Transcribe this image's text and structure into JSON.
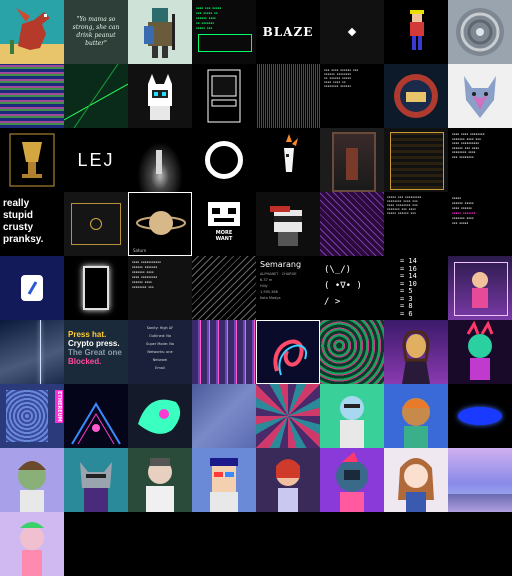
{
  "tiles": {
    "r1": {
      "quote": "\"Yo mama so strong, she can drink peanut butter\"",
      "blaze_logo": "BLAZE"
    },
    "r2": {},
    "r3": {
      "lej_text": "LEJ",
      "stupid_text": "really stupid crusty pranksy."
    },
    "r4": {
      "saturn_caption": "Saturn",
      "robot_word1": "MORE",
      "robot_word2": "WANT"
    },
    "r5": {
      "city_title": "Semarang",
      "city_lines": [
        "ALPHANET · CHARGE",
        "6.37 m",
        "Hilly",
        "1,995,388",
        "Kota Madya"
      ],
      "kaomoji": [
        "(\\_/)",
        "( •∇• )",
        "/ >"
      ],
      "numbers_eq": [
        "= 14",
        "= 16",
        "= 14",
        "= 10",
        "= 5",
        "= 3",
        "= 8",
        "= 6"
      ]
    },
    "r6": {
      "press_line1": "Press hat.",
      "press_line2": "Crypto press.",
      "press_line3": "The Great one",
      "press_line4": "Blocked.",
      "settings_lines": [
        "Sanity: High AF",
        "Outlined: No",
        "Super Mode: No",
        "Networks: one",
        "Network",
        "Email"
      ],
      "vert_label": "ETHEREUM"
    }
  },
  "colors": {
    "accent_green": "#00ff66",
    "accent_magenta": "#ff2bd6",
    "accent_cyan": "#20e0ff"
  }
}
